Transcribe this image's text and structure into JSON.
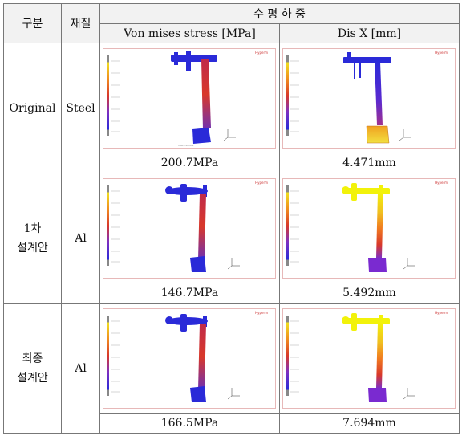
{
  "header": {
    "category": "구분",
    "material": "재질",
    "load_case": "수 평 하 중",
    "col_stress": "Von mises stress [MPa]",
    "col_disp": "Dis X [mm]"
  },
  "rows": [
    {
      "category_line1": "Original",
      "category_line2": "",
      "material": "Steel",
      "stress_value": "200.7MPa",
      "disp_value": "4.471mm",
      "stress_image": "fe-stress-contour-pedal",
      "disp_image": "fe-displacement-contour-pedal"
    },
    {
      "category_line1": "1차",
      "category_line2": "설계안",
      "material": "Al",
      "stress_value": "146.7MPa",
      "disp_value": "5.492mm",
      "stress_image": "fe-stress-contour-pedal",
      "disp_image": "fe-displacement-contour-pedal"
    },
    {
      "category_line1": "최종",
      "category_line2": "설계안",
      "material": "Al",
      "stress_value": "166.5MPa",
      "disp_value": "7.694mm",
      "stress_image": "fe-stress-contour-pedal",
      "disp_image": "fe-displacement-contour-pedal"
    }
  ],
  "colors": {
    "blue": "#2a2ad8",
    "red": "#d8382a",
    "yellow": "#f2f20a",
    "orange": "#f0a020",
    "border": "#777777",
    "header_bg": "#f2f2f2"
  }
}
